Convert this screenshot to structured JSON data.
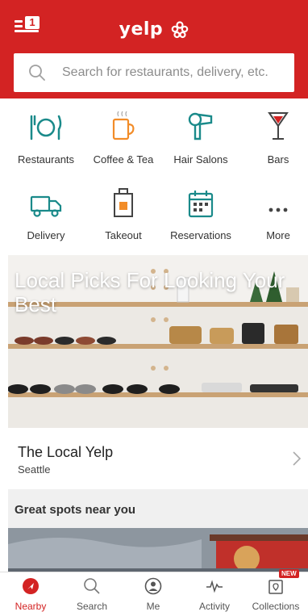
{
  "header": {
    "menu_badge": "1",
    "logo_text": "yelp",
    "search_placeholder": "Search for restaurants, delivery, etc."
  },
  "categories": [
    {
      "label": "Restaurants",
      "icon": "restaurants-icon"
    },
    {
      "label": "Coffee & Tea",
      "icon": "coffee-icon"
    },
    {
      "label": "Hair Salons",
      "icon": "hair-dryer-icon"
    },
    {
      "label": "Bars",
      "icon": "cocktail-icon"
    },
    {
      "label": "Delivery",
      "icon": "delivery-truck-icon"
    },
    {
      "label": "Takeout",
      "icon": "takeout-bag-icon"
    },
    {
      "label": "Reservations",
      "icon": "calendar-icon"
    },
    {
      "label": "More",
      "icon": "more-icon"
    }
  ],
  "hero": {
    "title": "Local Picks For Looking Your Best"
  },
  "card": {
    "title": "The Local Yelp",
    "subtitle": "Seattle"
  },
  "section": {
    "title": "Great spots near you"
  },
  "tabs": [
    {
      "label": "Nearby",
      "active": true
    },
    {
      "label": "Search",
      "active": false
    },
    {
      "label": "Me",
      "active": false
    },
    {
      "label": "Activity",
      "active": false
    },
    {
      "label": "Collections",
      "active": false,
      "badge": "NEW"
    }
  ],
  "colors": {
    "brand_red": "#d32323",
    "accent_teal": "#1a8a8a",
    "accent_orange": "#f28c28"
  }
}
